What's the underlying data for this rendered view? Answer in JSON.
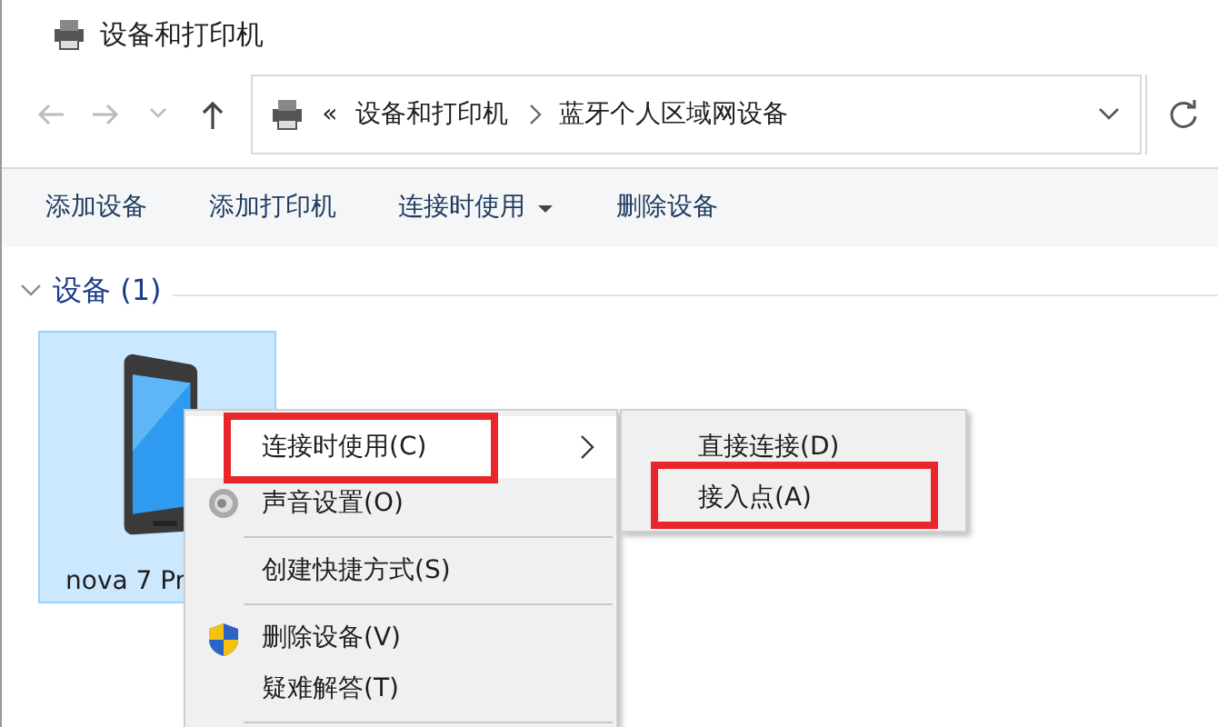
{
  "window": {
    "title": "设备和打印机"
  },
  "address": {
    "overflow": "«",
    "crumbs": [
      "设备和打印机",
      "蓝牙个人区域网设备"
    ]
  },
  "toolbar": [
    {
      "label": "添加设备",
      "dropdown": false
    },
    {
      "label": "添加打印机",
      "dropdown": false
    },
    {
      "label": "连接时使用",
      "dropdown": true
    },
    {
      "label": "删除设备",
      "dropdown": false
    }
  ],
  "group": {
    "title": "设备 (1)",
    "expanded": true
  },
  "devices": [
    {
      "name": "nova 7 Pr",
      "selected": true
    }
  ],
  "context_menu": [
    {
      "kind": "plain",
      "label": "连接时使用(C)",
      "submenu": true,
      "highlighted": true,
      "annotated": true
    },
    {
      "kind": "speaker",
      "label": "声音设置(O)",
      "submenu": false,
      "highlighted": false,
      "annotated": false
    },
    {
      "kind": "separator"
    },
    {
      "kind": "plain",
      "label": "创建快捷方式(S)",
      "submenu": false,
      "highlighted": false,
      "annotated": false
    },
    {
      "kind": "separator"
    },
    {
      "kind": "shield",
      "label": "删除设备(V)",
      "submenu": false,
      "highlighted": false,
      "annotated": false
    },
    {
      "kind": "plain",
      "label": "疑难解答(T)",
      "submenu": false,
      "highlighted": false,
      "annotated": false
    },
    {
      "kind": "separator"
    }
  ],
  "submenu": [
    {
      "label": "直接连接(D)",
      "annotated": false
    },
    {
      "label": "接入点(A)",
      "annotated": true
    }
  ]
}
